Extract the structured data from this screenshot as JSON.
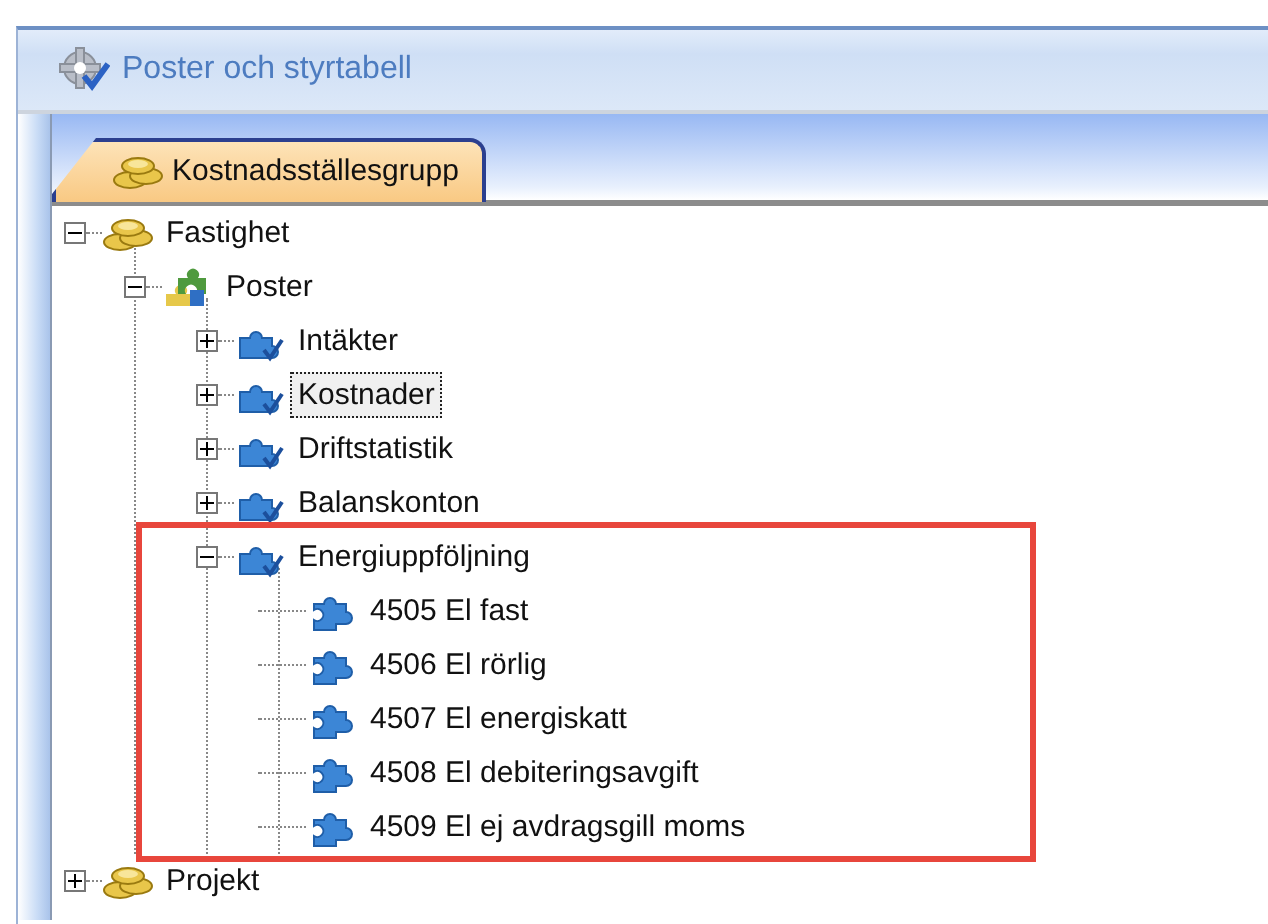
{
  "window": {
    "title": "Poster och styrtabell"
  },
  "tabs": [
    {
      "label": "Kostnadsställesgrupp",
      "selected": true
    }
  ],
  "tree": [
    {
      "label": "Fastighet",
      "kind": "coins",
      "expanded": true,
      "selected": false,
      "children": [
        {
          "label": "Poster",
          "kind": "multi",
          "expanded": true,
          "selected": false,
          "children": [
            {
              "label": "Intäkter",
              "kind": "puzzle",
              "expanded": false,
              "selected": false
            },
            {
              "label": "Kostnader",
              "kind": "puzzle",
              "expanded": false,
              "selected": true
            },
            {
              "label": "Driftstatistik",
              "kind": "puzzle",
              "expanded": false,
              "selected": false
            },
            {
              "label": "Balanskonton",
              "kind": "puzzle",
              "expanded": false,
              "selected": false
            },
            {
              "label": "Energiuppföljning",
              "kind": "puzzle",
              "expanded": true,
              "selected": false,
              "highlighted": true,
              "children": [
                {
                  "label": "4505 El fast",
                  "kind": "leaf",
                  "selected": false
                },
                {
                  "label": "4506 El rörlig",
                  "kind": "leaf",
                  "selected": false
                },
                {
                  "label": "4507 El energiskatt",
                  "kind": "leaf",
                  "selected": false
                },
                {
                  "label": "4508 El debiteringsavgift",
                  "kind": "leaf",
                  "selected": false
                },
                {
                  "label": "4509 El ej avdragsgill moms",
                  "kind": "leaf",
                  "selected": false
                }
              ]
            }
          ]
        }
      ]
    },
    {
      "label": "Projekt",
      "kind": "coins",
      "expanded": false,
      "selected": false
    }
  ]
}
